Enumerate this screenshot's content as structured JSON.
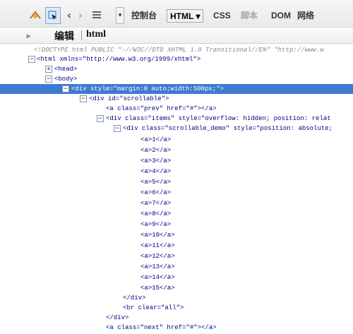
{
  "toolbar": {
    "tabs": [
      {
        "label": "控制台"
      },
      {
        "label": "HTML ▾"
      },
      {
        "label": "CSS"
      },
      {
        "label": "脚本"
      },
      {
        "label": "DOM"
      },
      {
        "label": "网络"
      }
    ]
  },
  "secondary": {
    "edit_label": "编辑",
    "breadcrumb": "html"
  },
  "dom": {
    "doctype": "<!DOCTYPE html PUBLIC \"-//W3C//DTD XHTML 1.0 Transitional//EN\" \"http://www.w",
    "html_open": "<html xmlns=\"http://www.w3.org/1999/xhtml\">",
    "head": "<head>",
    "body": "<body>",
    "div_style": "<div style=\"margin:0 auto;width:500px;\">",
    "div_id": "<div id=\"scrollable\">",
    "prev": "<a class=\"prev\" href=\"#\"></a>",
    "items": "<div class=\"items\" style=\"overflow: hidden; position: relat",
    "demo": "<div class=\"scrollable_demo\" style=\"position: absolute;",
    "anchors": [
      "<a>1</a>",
      "<a>2</a>",
      "<a>3</a>",
      "<a>4</a>",
      "<a>5</a>",
      "<a>6</a>",
      "<a>7</a>",
      "<a>8</a>",
      "<a>9</a>",
      "<a>10</a>",
      "<a>11</a>",
      "<a>12</a>",
      "<a>13</a>",
      "<a>14</a>",
      "<a>15</a>"
    ],
    "close_div1": "</div>",
    "br": "<br clear=\"all\">",
    "close_div2": "</div>",
    "next": "<a class=\"next\" href=\"#\"></a>"
  }
}
